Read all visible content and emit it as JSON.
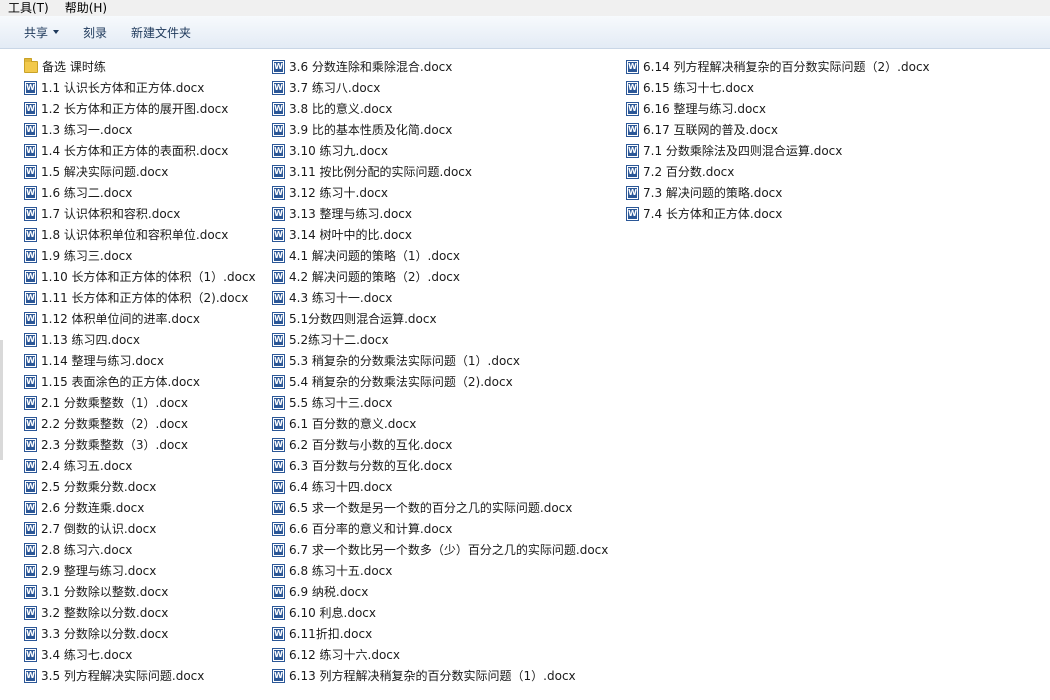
{
  "menubar": {
    "items": [
      "工具(T)",
      "帮助(H)"
    ]
  },
  "toolbar": {
    "share_label": "共享",
    "burn_label": "刻录",
    "new_folder_label": "新建文件夹"
  },
  "files": {
    "column1": [
      {
        "name": "备选 课时练",
        "icon": "folder-icon"
      },
      {
        "name": "1.1 认识长方体和正方体.docx",
        "icon": "word-doc-icon"
      },
      {
        "name": "1.2 长方体和正方体的展开图.docx",
        "icon": "word-doc-icon"
      },
      {
        "name": "1.3 练习一.docx",
        "icon": "word-doc-icon"
      },
      {
        "name": "1.4 长方体和正方体的表面积.docx",
        "icon": "word-doc-icon"
      },
      {
        "name": "1.5 解决实际问题.docx",
        "icon": "word-doc-icon"
      },
      {
        "name": "1.6 练习二.docx",
        "icon": "word-doc-icon"
      },
      {
        "name": "1.7 认识体积和容积.docx",
        "icon": "word-doc-icon"
      },
      {
        "name": "1.8 认识体积单位和容积单位.docx",
        "icon": "word-doc-icon"
      },
      {
        "name": "1.9 练习三.docx",
        "icon": "word-doc-icon"
      },
      {
        "name": "1.10 长方体和正方体的体积（1）.docx",
        "icon": "word-doc-icon"
      },
      {
        "name": "1.11 长方体和正方体的体积（2).docx",
        "icon": "word-doc-icon"
      },
      {
        "name": "1.12 体积单位间的进率.docx",
        "icon": "word-doc-icon"
      },
      {
        "name": "1.13 练习四.docx",
        "icon": "word-doc-icon"
      },
      {
        "name": "1.14 整理与练习.docx",
        "icon": "word-doc-icon"
      },
      {
        "name": "1.15 表面涂色的正方体.docx",
        "icon": "word-doc-icon"
      },
      {
        "name": "2.1 分数乘整数（1）.docx",
        "icon": "word-doc-icon"
      },
      {
        "name": "2.2 分数乘整数（2）.docx",
        "icon": "word-doc-icon"
      },
      {
        "name": "2.3 分数乘整数（3）.docx",
        "icon": "word-doc-icon"
      },
      {
        "name": "2.4 练习五.docx",
        "icon": "word-doc-icon"
      },
      {
        "name": "2.5 分数乘分数.docx",
        "icon": "word-doc-icon"
      },
      {
        "name": "2.6 分数连乘.docx",
        "icon": "word-doc-icon"
      },
      {
        "name": "2.7 倒数的认识.docx",
        "icon": "word-doc-icon"
      },
      {
        "name": "2.8 练习六.docx",
        "icon": "word-doc-icon"
      },
      {
        "name": "2.9 整理与练习.docx",
        "icon": "word-doc-icon"
      },
      {
        "name": "3.1 分数除以整数.docx",
        "icon": "word-doc-icon"
      },
      {
        "name": "3.2 整数除以分数.docx",
        "icon": "word-doc-icon"
      },
      {
        "name": "3.3 分数除以分数.docx",
        "icon": "word-doc-icon"
      },
      {
        "name": "3.4 练习七.docx",
        "icon": "word-doc-icon"
      },
      {
        "name": "3.5 列方程解决实际问题.docx",
        "icon": "word-doc-icon"
      }
    ],
    "column2": [
      {
        "name": "3.6 分数连除和乘除混合.docx",
        "icon": "word-doc-icon"
      },
      {
        "name": "3.7 练习八.docx",
        "icon": "word-doc-icon"
      },
      {
        "name": "3.8 比的意义.docx",
        "icon": "word-doc-icon"
      },
      {
        "name": "3.9 比的基本性质及化简.docx",
        "icon": "word-doc-icon"
      },
      {
        "name": "3.10 练习九.docx",
        "icon": "word-doc-icon"
      },
      {
        "name": "3.11 按比例分配的实际问题.docx",
        "icon": "word-doc-icon"
      },
      {
        "name": "3.12 练习十.docx",
        "icon": "word-doc-icon"
      },
      {
        "name": "3.13 整理与练习.docx",
        "icon": "word-doc-icon"
      },
      {
        "name": "3.14 树叶中的比.docx",
        "icon": "word-doc-icon"
      },
      {
        "name": "4.1 解决问题的策略（1）.docx",
        "icon": "word-doc-icon"
      },
      {
        "name": "4.2 解决问题的策略（2）.docx",
        "icon": "word-doc-icon"
      },
      {
        "name": "4.3 练习十一.docx",
        "icon": "word-doc-icon"
      },
      {
        "name": "5.1分数四则混合运算.docx",
        "icon": "word-doc-icon"
      },
      {
        "name": "5.2练习十二.docx",
        "icon": "word-doc-icon"
      },
      {
        "name": "5.3 稍复杂的分数乘法实际问题（1）.docx",
        "icon": "word-doc-icon"
      },
      {
        "name": "5.4 稍复杂的分数乘法实际问题（2).docx",
        "icon": "word-doc-icon"
      },
      {
        "name": "5.5 练习十三.docx",
        "icon": "word-doc-icon"
      },
      {
        "name": "6.1 百分数的意义.docx",
        "icon": "word-doc-icon"
      },
      {
        "name": "6.2 百分数与小数的互化.docx",
        "icon": "word-doc-icon"
      },
      {
        "name": "6.3 百分数与分数的互化.docx",
        "icon": "word-doc-icon"
      },
      {
        "name": "6.4 练习十四.docx",
        "icon": "word-doc-icon"
      },
      {
        "name": "6.5 求一个数是另一个数的百分之几的实际问题.docx",
        "icon": "word-doc-icon"
      },
      {
        "name": "6.6 百分率的意义和计算.docx",
        "icon": "word-doc-icon"
      },
      {
        "name": "6.7 求一个数比另一个数多（少）百分之几的实际问题.docx",
        "icon": "word-doc-icon"
      },
      {
        "name": "6.8 练习十五.docx",
        "icon": "word-doc-icon"
      },
      {
        "name": "6.9 纳税.docx",
        "icon": "word-doc-icon"
      },
      {
        "name": "6.10 利息.docx",
        "icon": "word-doc-icon"
      },
      {
        "name": "6.11折扣.docx",
        "icon": "word-doc-icon"
      },
      {
        "name": "6.12 练习十六.docx",
        "icon": "word-doc-icon"
      },
      {
        "name": "6.13 列方程解决稍复杂的百分数实际问题（1）.docx",
        "icon": "word-doc-icon"
      }
    ],
    "column3": [
      {
        "name": "6.14 列方程解决稍复杂的百分数实际问题（2）.docx",
        "icon": "word-doc-icon"
      },
      {
        "name": "6.15 练习十七.docx",
        "icon": "word-doc-icon"
      },
      {
        "name": "6.16 整理与练习.docx",
        "icon": "word-doc-icon"
      },
      {
        "name": "6.17 互联网的普及.docx",
        "icon": "word-doc-icon"
      },
      {
        "name": "7.1 分数乘除法及四则混合运算.docx",
        "icon": "word-doc-icon"
      },
      {
        "name": "7.2 百分数.docx",
        "icon": "word-doc-icon"
      },
      {
        "name": "7.3 解决问题的策略.docx",
        "icon": "word-doc-icon"
      },
      {
        "name": "7.4 长方体和正方体.docx",
        "icon": "word-doc-icon"
      }
    ]
  }
}
